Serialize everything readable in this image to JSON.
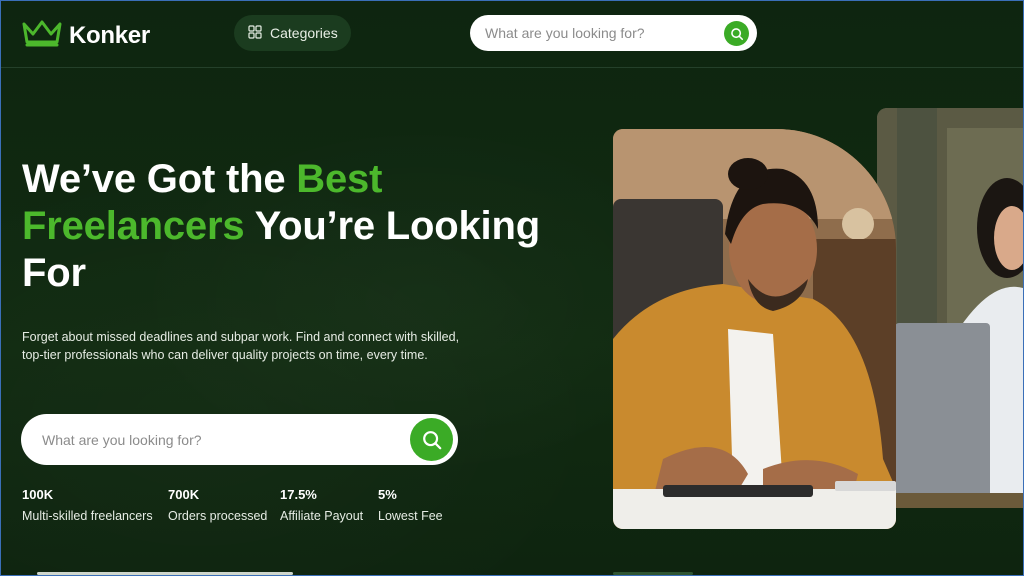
{
  "header": {
    "brand": "Konker",
    "categories_label": "Categories",
    "search_placeholder": "What are you looking for?"
  },
  "hero": {
    "title_part1": "We’ve Got the ",
    "title_accent1": "Best",
    "title_accent2": "Freelancers",
    "title_part2": " You’re Looking For",
    "subtitle": "Forget about missed deadlines and subpar work. Find and connect with skilled, top-tier professionals who can deliver quality projects on time, every time.",
    "search_placeholder": "What are you looking for?"
  },
  "stats": [
    {
      "value": "100K",
      "label": "Multi-skilled freelancers"
    },
    {
      "value": "700K",
      "label": "Orders processed"
    },
    {
      "value": "17.5%",
      "label": "Affiliate Payout"
    },
    {
      "value": "5%",
      "label": "Lowest Fee"
    }
  ],
  "colors": {
    "background": "#0f2710",
    "accent": "#4cb82c",
    "button_green": "#3bab26"
  },
  "icons": {
    "logo": "crown-icon",
    "categories": "grid-icon",
    "search": "search-icon"
  }
}
